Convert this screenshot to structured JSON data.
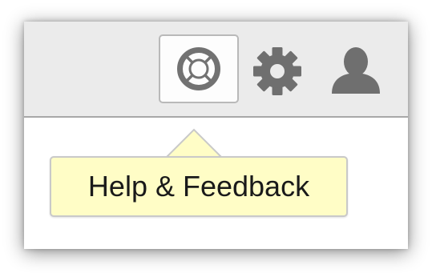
{
  "toolbar": {
    "buttons": [
      {
        "name": "help-button",
        "icon": "lifebuoy-icon",
        "selected": true
      },
      {
        "name": "settings-button",
        "icon": "gear-icon"
      },
      {
        "name": "account-button",
        "icon": "person-icon"
      }
    ]
  },
  "tooltip": {
    "text": "Help & Feedback",
    "background": "#fffdc6"
  },
  "colors": {
    "toolbar_bg": "#ebebeb",
    "icon": "#6f6f6f",
    "divider": "#a8a8a8"
  }
}
